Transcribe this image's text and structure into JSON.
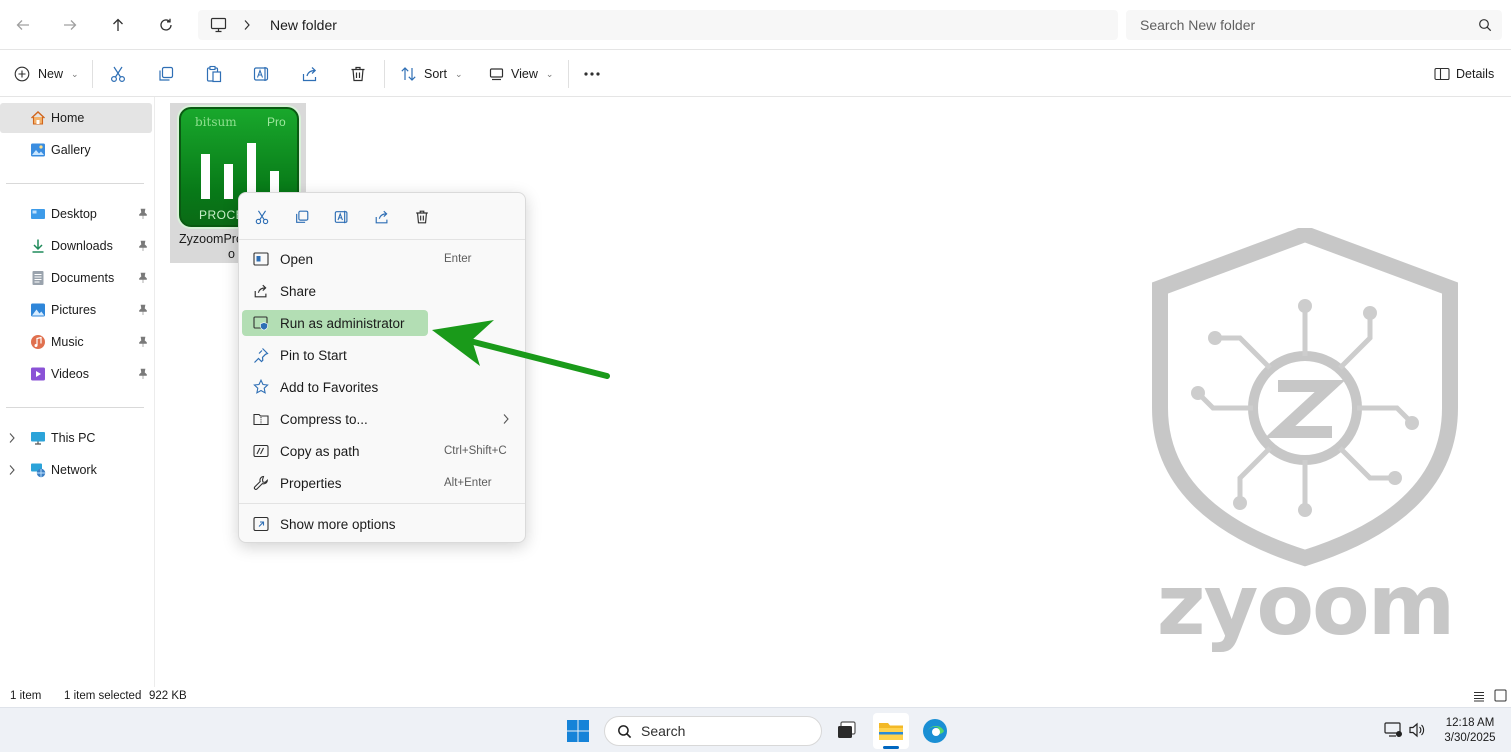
{
  "addressbar": {
    "crumb": "New folder",
    "search_placeholder": "Search New folder"
  },
  "commandbar": {
    "new_label": "New",
    "sort_label": "Sort",
    "view_label": "View",
    "details_label": "Details"
  },
  "sidebar": {
    "home": "Home",
    "gallery": "Gallery",
    "quick": [
      "Desktop",
      "Downloads",
      "Documents",
      "Pictures",
      "Music",
      "Videos"
    ],
    "this_pc": "This PC",
    "network": "Network"
  },
  "content": {
    "file_name_line1": "ZyzoomPro",
    "file_name_line2": "o",
    "icon_brand": "bitsum",
    "icon_badge": "Pro",
    "icon_caption": "PROCES"
  },
  "context_menu": {
    "items": [
      {
        "label": "Open",
        "shortcut": "Enter"
      },
      {
        "label": "Share",
        "shortcut": ""
      },
      {
        "label": "Run as administrator",
        "shortcut": ""
      },
      {
        "label": "Pin to Start",
        "shortcut": ""
      },
      {
        "label": "Add to Favorites",
        "shortcut": ""
      },
      {
        "label": "Compress to...",
        "shortcut": ""
      },
      {
        "label": "Copy as path",
        "shortcut": "Ctrl+Shift+C"
      },
      {
        "label": "Properties",
        "shortcut": "Alt+Enter"
      },
      {
        "label": "Show more options",
        "shortcut": ""
      }
    ],
    "highlight_color": "#b3deb4"
  },
  "statusbar": {
    "count": "1 item",
    "selected": "1 item selected",
    "size": "922 KB"
  },
  "taskbar": {
    "search_placeholder": "Search",
    "time": "12:18 AM",
    "date": "3/30/2025"
  },
  "watermark": {
    "text": "zyoom"
  },
  "colors": {
    "accent": "#0067c0",
    "arrow": "#1a9a1a",
    "app_icon_green": "#0e8a1e"
  }
}
